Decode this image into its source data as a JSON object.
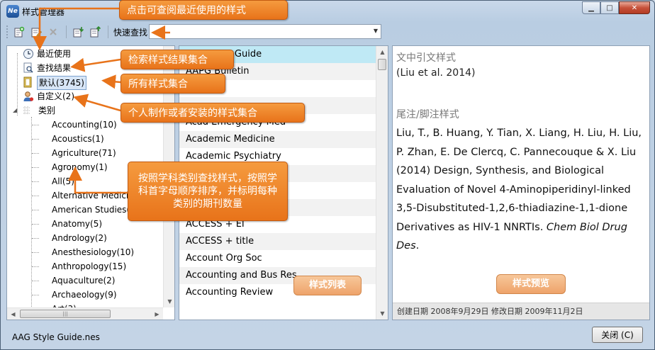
{
  "window": {
    "icon_text": "Ne",
    "title": "样式管理器",
    "minimize": "▁",
    "maximize": "□",
    "close": "✕"
  },
  "toolbar": {
    "icons": [
      "new-style-icon",
      "edit-style-icon",
      "delete-style-icon",
      "import-style-icon",
      "export-style-icon"
    ],
    "quick_search_label": "快速查找",
    "search_value": ""
  },
  "tree": {
    "recent": "最近使用",
    "search_results": "查找结果",
    "default": "默认(3745)",
    "custom": "自定义(2)",
    "categories": "类别",
    "category_items": [
      "Accounting(10)",
      "Acoustics(1)",
      "Agriculture(71)",
      "Agronomy(1)",
      "All(5)",
      "Alternative Medicine",
      "American Studies(2",
      "Anatomy(5)",
      "Andrology(2)",
      "Anesthesiology(10)",
      "Anthropology(15)",
      "Aquaculture(2)",
      "Archaeology(9)",
      "Art(3)"
    ]
  },
  "style_list": {
    "items": [
      "AAG Style Guide",
      "AAPG Bulletin",
      "",
      "",
      "Acad Emergency Med",
      "Academic Medicine",
      "Academic Psychiatry",
      "",
      "",
      "",
      "ACCESS + EI",
      "ACCESS + title",
      "Account Org Soc",
      "Accounting and Bus Res",
      "Accounting Review"
    ],
    "selected_index": 0
  },
  "preview": {
    "intext_heading": "文中引文样式",
    "intext_citation": "(Liu et al. 2014)",
    "footnote_heading": "尾注/脚注样式",
    "bibliography_text": "Liu, T., B. Huang, Y. Tian, X. Liang, H. Liu, H. Liu, P. Zhan, E. De Clercq, C. Pannecouque & X. Liu (2014) Design, Synthesis, and Biological Evaluation of Novel 4-Aminopiperidinyl-linked 3,5-Disubstituted-1,2,6-thiadiazine-1,1-dione Derivatives as HIV-1 NNRTIs.",
    "bibliography_journal": "Chem Biol Drug Des",
    "bibliography_end": ".",
    "created_label": "创建日期",
    "created_date": "2008年9月29日",
    "modified_label": "修改日期",
    "modified_date": "2009年11月2日"
  },
  "annotations": {
    "recent_tip": "点击可查阅最近使用的样式",
    "search_tip": "检索样式结果集合",
    "all_tip": "所有样式集合",
    "custom_tip": "个人制作或者安装的样式集合",
    "category_tip": "按照学科类别查找样式，按照学科首字母顺序排序，并标明每种类别的期刊数量",
    "list_tag": "样式列表",
    "preview_tag": "样式预览"
  },
  "status": {
    "filename": "AAG Style Guide.nes",
    "close_button": "关闭 (C)"
  },
  "colors": {
    "callout": "#e8731a",
    "selection": "#bfe9f5",
    "tag": "#eea36a"
  }
}
